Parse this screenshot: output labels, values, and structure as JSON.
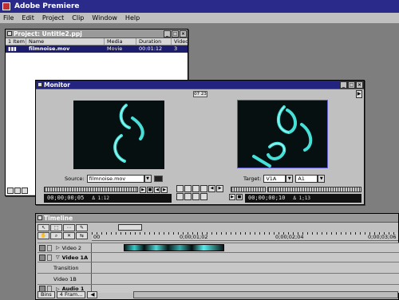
{
  "app": {
    "title": "Adobe Premiere"
  },
  "menu": [
    "File",
    "Edit",
    "Project",
    "Clip",
    "Window",
    "Help"
  ],
  "project": {
    "title": "Project: Untitle2.ppj",
    "columns": [
      "1 Item",
      "Name",
      "Media Type",
      "Duration",
      "Video"
    ],
    "rows": [
      {
        "name": "filmnoise.mov",
        "type": "Movie",
        "duration": "00:01:12",
        "video": "3"
      }
    ]
  },
  "monitor": {
    "title": "Monitor",
    "badge": "07 23",
    "source": {
      "label": "Source:",
      "value": "filmnoise.mov",
      "timecode": "00;00;00;05",
      "duration": "Δ 1:12"
    },
    "target": {
      "label": "Target:",
      "track_v": "V1A",
      "track_a": "A1",
      "timecode": "00;00;00;10",
      "duration": "Δ 1;13"
    }
  },
  "timeline": {
    "title": "Timeline",
    "ruler": [
      "00",
      "0;00;01;02",
      "0;00;02;04",
      "0;00;03;06"
    ],
    "tracks": [
      {
        "name": "Video 2"
      },
      {
        "name": "Video 1A"
      },
      {
        "name": "Transition"
      },
      {
        "name": "Video 1B"
      },
      {
        "name": "Audio 1"
      }
    ],
    "footer": {
      "bins": "Bins",
      "frames": "4 Fram..."
    }
  }
}
